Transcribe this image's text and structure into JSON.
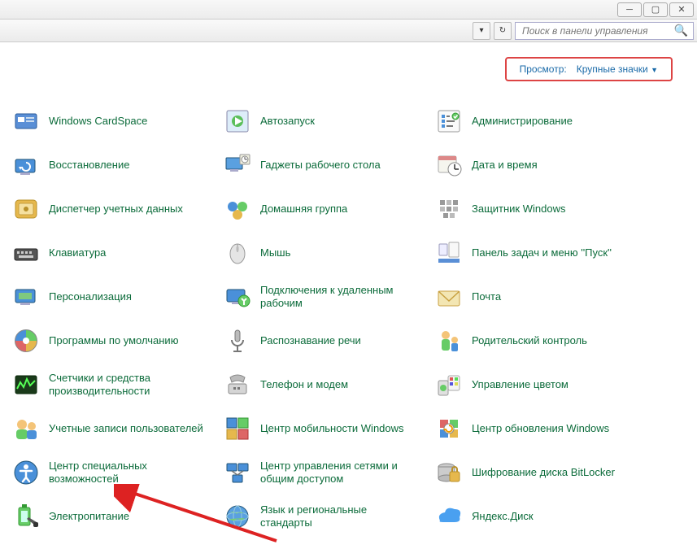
{
  "window": {
    "min": "─",
    "max": "▢",
    "close": "✕"
  },
  "toolbar": {
    "dd": "▾",
    "refresh": "↻"
  },
  "search": {
    "placeholder": "Поиск в панели управления"
  },
  "view": {
    "label": "Просмотр:",
    "value": "Крупные значки"
  },
  "items": [
    {
      "label": "Windows CardSpace"
    },
    {
      "label": "Автозапуск"
    },
    {
      "label": "Администрирование"
    },
    {
      "label": "Восстановление"
    },
    {
      "label": "Гаджеты рабочего стола"
    },
    {
      "label": "Дата и время"
    },
    {
      "label": "Диспетчер учетных данных"
    },
    {
      "label": "Домашняя группа"
    },
    {
      "label": "Защитник Windows"
    },
    {
      "label": "Клавиатура"
    },
    {
      "label": "Мышь"
    },
    {
      "label": "Панель задач и меню ''Пуск''"
    },
    {
      "label": "Персонализация"
    },
    {
      "label": "Подключения к удаленным рабочим"
    },
    {
      "label": "Почта"
    },
    {
      "label": "Программы по умолчанию"
    },
    {
      "label": "Распознавание речи"
    },
    {
      "label": "Родительский контроль"
    },
    {
      "label": "Счетчики и средства производительности"
    },
    {
      "label": "Телефон и модем"
    },
    {
      "label": "Управление цветом"
    },
    {
      "label": "Учетные записи пользователей"
    },
    {
      "label": "Центр мобильности Windows"
    },
    {
      "label": "Центр обновления Windows"
    },
    {
      "label": "Центр специальных возможностей"
    },
    {
      "label": "Центр управления сетями и общим доступом"
    },
    {
      "label": "Шифрование диска BitLocker"
    },
    {
      "label": "Электропитание"
    },
    {
      "label": "Язык и региональные стандарты"
    },
    {
      "label": "Яндекс.Диск"
    }
  ]
}
